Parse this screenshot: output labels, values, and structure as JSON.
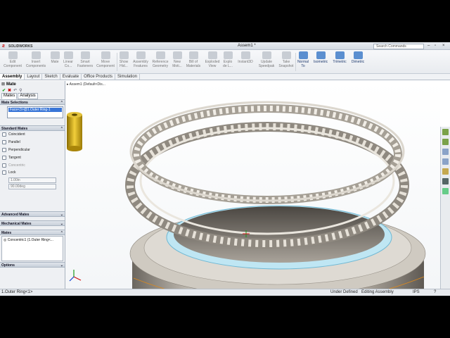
{
  "window": {
    "app_logo_text": "SOLIDWORKS",
    "title": "Assem1 *",
    "search_placeholder": "Search Commands"
  },
  "toolbar": {
    "buttons": [
      {
        "label": "Edit Component"
      },
      {
        "label": "Insert Components"
      },
      {
        "label": "Mate"
      },
      {
        "label": "Linear Co..."
      },
      {
        "label": "Smart Fasteners"
      },
      {
        "label": "Move Component"
      },
      {
        "label": "Show Hid..."
      },
      {
        "label": "Assembly Features"
      },
      {
        "label": "Reference Geometry"
      },
      {
        "label": "New Moti..."
      },
      {
        "label": "Bill of Materials"
      },
      {
        "label": "Exploded View"
      },
      {
        "label": "Explo de L..."
      },
      {
        "label": "Instant3D"
      },
      {
        "label": "Update Speedpak"
      },
      {
        "label": "Take Snapshot"
      },
      {
        "label": "Normal To"
      },
      {
        "label": "Isometric"
      },
      {
        "label": "Trimetric"
      },
      {
        "label": "Dimetric"
      }
    ]
  },
  "tabs": [
    "Assembly",
    "Layout",
    "Sketch",
    "Evaluate",
    "Office Products",
    "Simulation"
  ],
  "panel": {
    "title": "Mate",
    "subtabs": [
      "Mates",
      "Analysis"
    ],
    "sections": {
      "mate_selections": "Mate Selections",
      "standard_mates": "Standard Mates",
      "advanced_mates": "Advanced Mates",
      "mechanical_mates": "Mechanical Mates",
      "mates": "Mates",
      "options": "Options"
    },
    "selection": "Face<3>@1.Outer Ring-1",
    "standard_mates": [
      "Coincident",
      "Parallel",
      "Perpendicular",
      "Tangent",
      "Concentric",
      "Lock"
    ],
    "distance_value": "1.00in",
    "angle_value": "90.00deg",
    "mates_list": [
      "Concentric1 (1.Outer Ring<..."
    ]
  },
  "viewport": {
    "tree_flyout": "Assem1 (Default<Dis..."
  },
  "status": {
    "selected": "1.Outer Ring<1>",
    "state": "Under Defined",
    "mode": "Editing Assembly",
    "units": "IPS"
  },
  "colors": {
    "accent": "#3875d7",
    "ok": "#1a9a1a",
    "cancel": "#cc0000"
  }
}
